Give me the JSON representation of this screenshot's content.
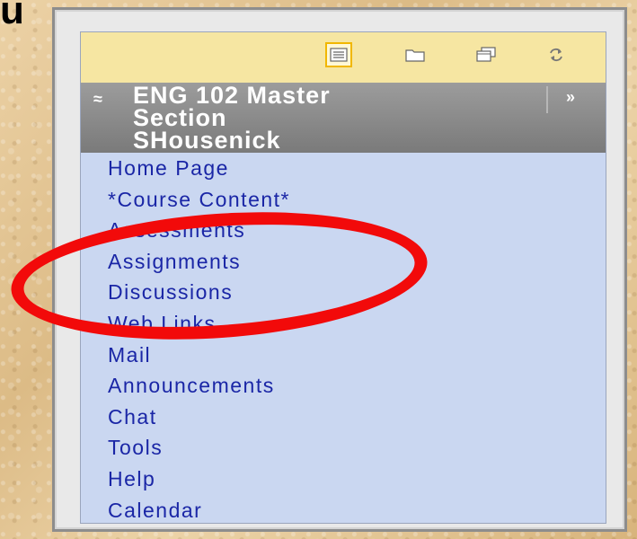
{
  "corner_text": "u",
  "toolbar": {
    "icons": [
      "list-icon",
      "folder-icon",
      "windows-icon",
      "refresh-icon"
    ]
  },
  "course": {
    "title": "ENG 102 Master\nSection\nSHousenick",
    "collapse_glyph": "≈",
    "expand_glyph": "»"
  },
  "nav": {
    "items": [
      {
        "label": "Home Page"
      },
      {
        "label": "*Course Content*"
      },
      {
        "label": "Assessments"
      },
      {
        "label": "Assignments"
      },
      {
        "label": "Discussions"
      },
      {
        "label": "Web Links"
      },
      {
        "label": "Mail"
      },
      {
        "label": "Announcements"
      },
      {
        "label": "Chat"
      },
      {
        "label": "Tools"
      },
      {
        "label": "Help"
      },
      {
        "label": "Calendar"
      }
    ]
  },
  "colors": {
    "link": "#1a26a6",
    "highlight": "#f20a0a",
    "toolbar_bg": "#f6e6a2",
    "nav_bg": "#cad7f1",
    "header_bg": "#8a8a8a"
  }
}
